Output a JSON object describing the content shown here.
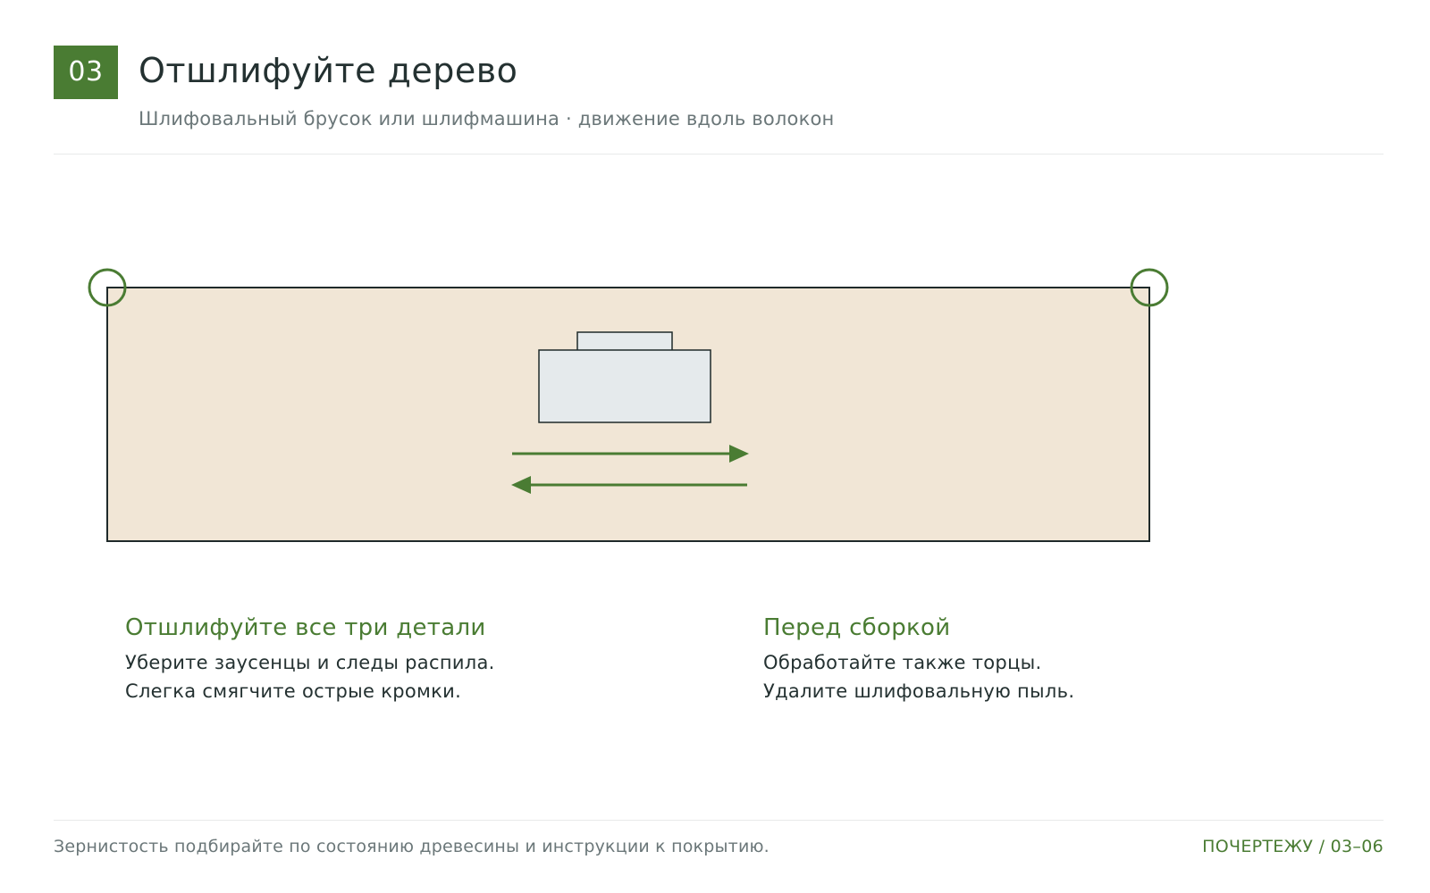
{
  "header": {
    "step_number": "03",
    "title": "Отшлифуйте дерево",
    "subtitle": "Шлифовальный брусок или шлифмашина · движение вдоль волокон"
  },
  "notes": [
    {
      "heading": "Отшлифуйте все три детали",
      "lines": [
        "Уберите заусенцы и следы распила.",
        "Слегка смягчите острые кромки."
      ]
    },
    {
      "heading": "Перед сборкой",
      "lines": [
        "Обработайте также торцы.",
        "Удалите шлифовальную пыль."
      ]
    }
  ],
  "footer": {
    "note": "Зернистость подбирайте по состоянию древесины и инструкции к покрытию.",
    "ref": "ПОЧЕРТЕЖУ / 03–06"
  },
  "colors": {
    "accent": "#4a7c33",
    "wood": "#f1e6d6",
    "sander": "#e5eaec",
    "text": "#243131",
    "muted": "#6b7779"
  },
  "icons": {
    "corner_marker": "circle-marker-icon",
    "direction_forward": "arrow-right-icon",
    "direction_back": "arrow-left-icon",
    "sander": "sanding-block-icon"
  }
}
